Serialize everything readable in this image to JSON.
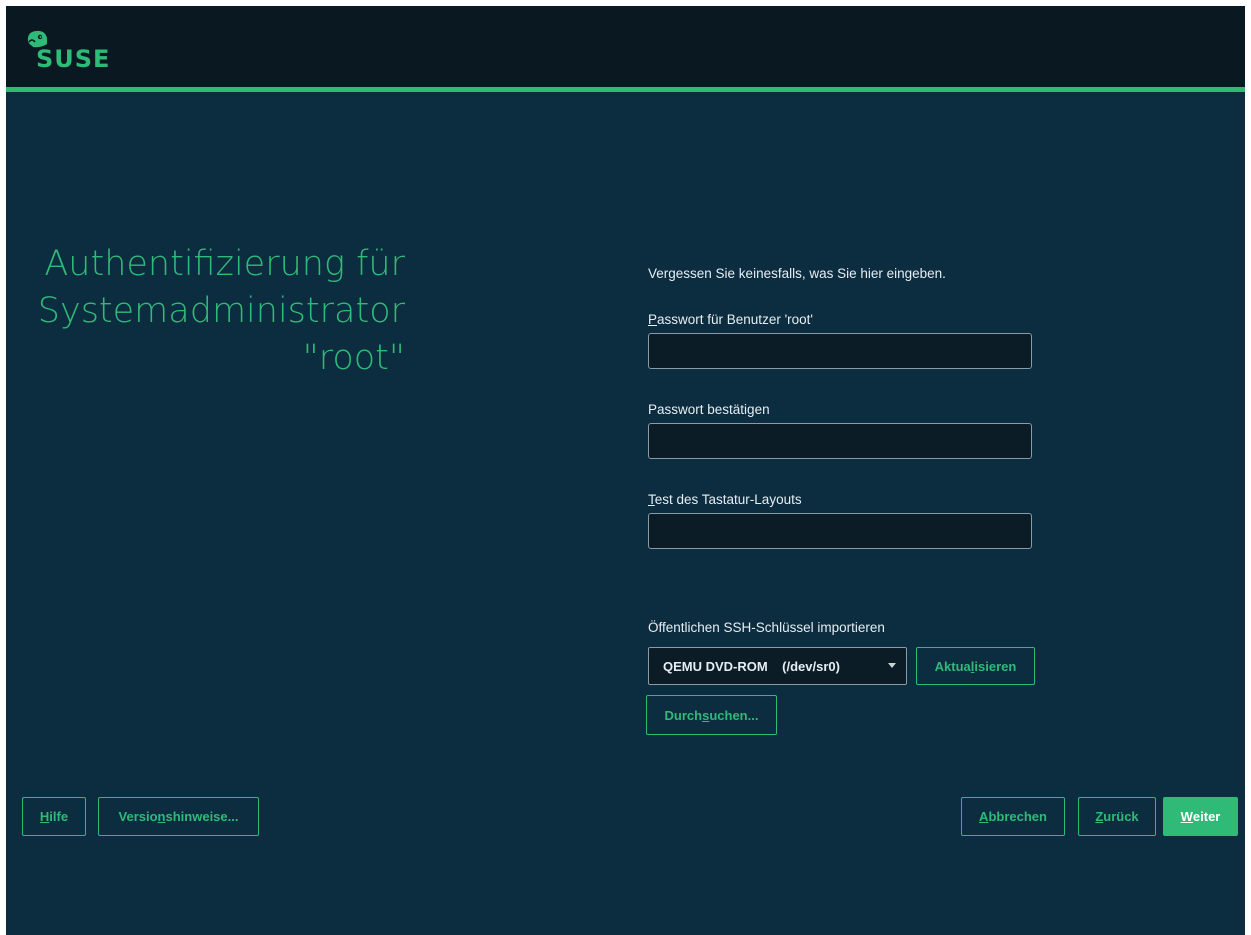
{
  "header": {
    "logo_text": "SUSE"
  },
  "title": {
    "line1": "Authentifizierung für",
    "line2": "Systemadministrator",
    "line3": "\"root\""
  },
  "form": {
    "hint": "Vergessen Sie keinesfalls, was Sie hier eingeben.",
    "password": {
      "label_accel": "P",
      "label_rest": "asswort für Benutzer 'root'",
      "value": ""
    },
    "confirm": {
      "label_pre": "Passwort bestäti",
      "label_accel": "g",
      "label_post": "en",
      "value": ""
    },
    "keyboard_test": {
      "label_accel": "T",
      "label_rest": "est des Tastatur-Layouts",
      "value": ""
    },
    "ssh": {
      "label": "Öffentlichen SSH-Schlüssel importieren",
      "device": "QEMU DVD-ROM    (/dev/sr0)",
      "refresh_pre": "Aktua",
      "refresh_accel": "l",
      "refresh_post": "isieren",
      "browse_pre": "Durch",
      "browse_accel": "s",
      "browse_post": "uchen..."
    }
  },
  "footer": {
    "help_accel": "H",
    "help_rest": "ilfe",
    "notes_pre": "Versio",
    "notes_accel": "n",
    "notes_post": "shinweise...",
    "abort_accel": "A",
    "abort_rest": "bbrechen",
    "back_accel": "Z",
    "back_rest": "urück",
    "next_accel": "W",
    "next_rest": "eiter"
  },
  "colors": {
    "background": "#0c2c40",
    "header": "#0a1822",
    "accent": "#30ba78",
    "text": "#e6eef2"
  }
}
